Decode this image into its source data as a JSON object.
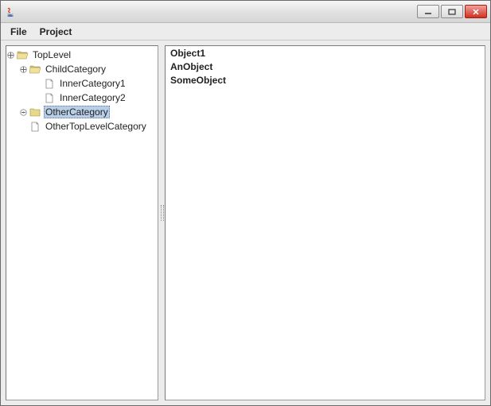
{
  "menu": {
    "file": "File",
    "project": "Project"
  },
  "tree": {
    "root": "TopLevel",
    "child1": "ChildCategory",
    "inner1": "InnerCategory1",
    "inner2": "InnerCategory2",
    "other": "OtherCategory",
    "othertop": "OtherTopLevelCategory"
  },
  "list": {
    "item0": "Object1",
    "item1": "AnObject",
    "item2": "SomeObject"
  },
  "icons": {
    "java": "java-icon",
    "minimize": "minimize-icon",
    "maximize": "maximize-icon",
    "close": "close-icon"
  }
}
